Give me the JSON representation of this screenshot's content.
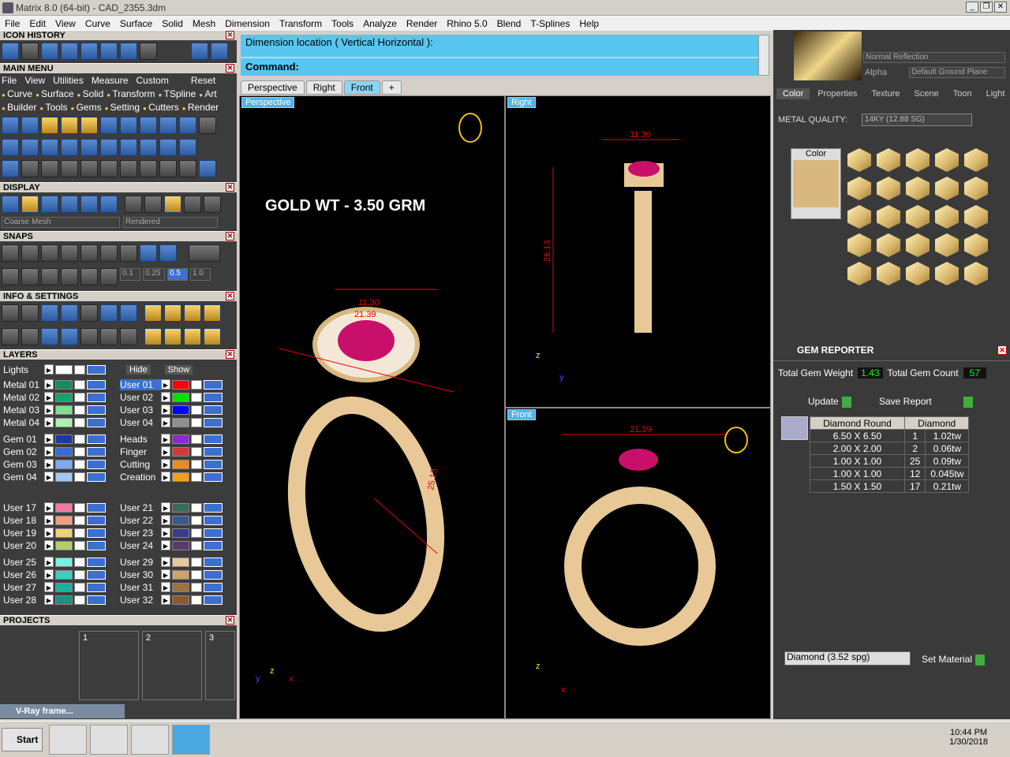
{
  "window": {
    "title": "Matrix 8.0 (64-bit) - CAD_2355.3dm"
  },
  "menu": [
    "File",
    "Edit",
    "View",
    "Curve",
    "Surface",
    "Solid",
    "Mesh",
    "Dimension",
    "Transform",
    "Tools",
    "Analyze",
    "Render",
    "Rhino 5.0",
    "Blend",
    "T-Splines",
    "Help"
  ],
  "left": {
    "icon_history": "ICON HISTORY",
    "main_menu": "MAIN MENU",
    "main_menu_items": [
      "File",
      "View",
      "Utilities",
      "Measure",
      "Custom",
      "Reset"
    ],
    "row1": [
      "Curve",
      "Surface",
      "Solid",
      "Transform",
      "TSpline",
      "Art"
    ],
    "row2": [
      "Builder",
      "Tools",
      "Gems",
      "Setting",
      "Cutters",
      "Render"
    ],
    "display": "DISPLAY",
    "display_mesh": "Coarse Mesh",
    "display_render": "Rendered",
    "snaps": "SNAPS",
    "snap_values": [
      "0.1",
      "0.25",
      "0.5",
      "1.0"
    ],
    "info_settings": "INFO & SETTINGS",
    "layers": "LAYERS",
    "lights": "Lights",
    "hide": "Hide",
    "show": "Show",
    "layers_left": [
      "Metal 01",
      "Metal 02",
      "Metal 03",
      "Metal 04",
      "Gem 01",
      "Gem 02",
      "Gem 03",
      "Gem 04",
      "User 17",
      "User 18",
      "User 19",
      "User 20",
      "User 25",
      "User 26",
      "User 27",
      "User 28"
    ],
    "layers_right": [
      "User 01",
      "User 02",
      "User 03",
      "User 04",
      "Heads",
      "Finger",
      "Cutting",
      "Creation",
      "User 21",
      "User 22",
      "User 23",
      "User 24",
      "User 29",
      "User 30",
      "User 31",
      "User 32"
    ],
    "layer_colors_left": [
      "#1a8a5a",
      "#1aa06a",
      "#7ee08e",
      "#b0f0b0",
      "#1a3aa0",
      "#3a6ad0",
      "#7aaaf0",
      "#a0c8f8",
      "#f07aa0",
      "#f0a07a",
      "#f0d07a",
      "#b0d06a",
      "#7af0e0",
      "#3ad0c0",
      "#1ab0a0",
      "#1a9080"
    ],
    "layer_colors_right": [
      "#ff0000",
      "#00e000",
      "#0000ff",
      "#909090",
      "#8a2ad0",
      "#d03a3a",
      "#f08a1a",
      "#f0a01a",
      "#3a6a5a",
      "#3a5a8a",
      "#3a3a8a",
      "#5a3a6a",
      "#e8c8a0",
      "#d0a070",
      "#a07040",
      "#8a5a2a"
    ],
    "projects": "PROJECTS",
    "project_slots": [
      "1",
      "2",
      "3"
    ],
    "vray": "V-Ray frame..."
  },
  "command": {
    "prompt": "Dimension location ( Vertical  Horizontal ):",
    "label": "Command:"
  },
  "view_tabs": [
    "Perspective",
    "Right",
    "Front"
  ],
  "viewports": {
    "perspective": "Perspective",
    "right": "Right",
    "front": "Front",
    "gold_wt": "GOLD WT - 3.50 GRM",
    "dim_persp_1": "11.30",
    "dim_persp_2": "21.39",
    "dim_persp_3": "25.13",
    "dim_right_w": "11.30",
    "dim_right_h": "25.13",
    "dim_front_w": "21.39"
  },
  "right": {
    "normal_reflection": "Normal Reflection",
    "alpha": "Alpha",
    "ground": "Default Ground Plane",
    "tabs": [
      "Color",
      "Properties",
      "Texture",
      "Scene",
      "Toon",
      "Light"
    ],
    "metal_quality_label": "METAL QUALITY:",
    "metal_quality_value": "14KY          (12.88 SG)",
    "color_label": "Color",
    "gem_reporter": "GEM REPORTER",
    "total_gem_weight_label": "Total Gem Weight",
    "total_gem_weight": "1.43",
    "total_gem_count_label": "Total Gem Count",
    "total_gem_count": "57",
    "update": "Update",
    "save_report": "Save Report",
    "table_head": [
      "Diamond Round",
      "Diamond"
    ],
    "rows": [
      {
        "size": "6.50 X 6.50",
        "qty": "1",
        "wt": "1.02tw"
      },
      {
        "size": "2.00 X 2.00",
        "qty": "2",
        "wt": "0.06tw"
      },
      {
        "size": "1.00 X 1.00",
        "qty": "25",
        "wt": "0.09tw"
      },
      {
        "size": "1.00 X 1.00",
        "qty": "12",
        "wt": "0.045tw"
      },
      {
        "size": "1.50 X 1.50",
        "qty": "17",
        "wt": "0.21tw"
      }
    ],
    "material": "Diamond      (3.52 spg)",
    "set_material": "Set Material"
  },
  "taskbar": {
    "start": "Start",
    "time": "10:44 PM",
    "date": "1/30/2018"
  }
}
